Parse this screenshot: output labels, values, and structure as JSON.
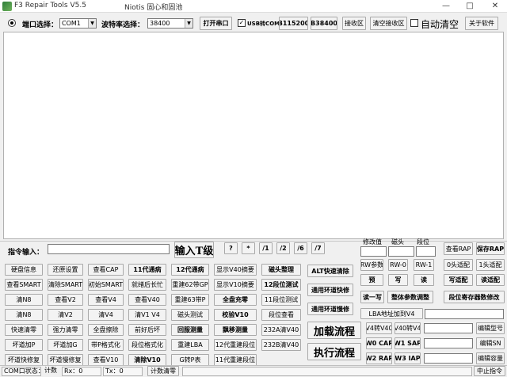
{
  "window": {
    "title": "F3 Repair Tools V5.5",
    "subtitle": "Niotis  固心和固池",
    "min": "—",
    "max": "□",
    "close": "✕"
  },
  "toolbar": {
    "port_label": "端口选择：",
    "port_value": "COM1",
    "baud_label": "波特率选择：",
    "baud_value": "38400",
    "open_port": "打开串口",
    "usb_label": "USB转COM",
    "usb_checked": "✓",
    "b115200": "B115200",
    "b38400": "B38400",
    "receive_area": "接收区",
    "clear_receive": "清空接收区",
    "auto_clear": "自动清空",
    "about": "关于软件"
  },
  "cmd": {
    "label": "指令输入：",
    "value": "",
    "enter_t": "输入T级",
    "btns": [
      "?",
      "*",
      "/1",
      "/2",
      "/6",
      "/7"
    ]
  },
  "right_panel": {
    "modify_label": "修改值",
    "head_label": "磁头",
    "segment_label": "段位",
    "rw_params": "RW参数",
    "rw0": "RW-0",
    "rw1": "RW-1",
    "preset": "预",
    "write": "写",
    "read": "读",
    "read_write": "读一写",
    "adjust_all": "整体参数调整",
    "lba_to_v4": "LBA地址加到V4",
    "v4_to_v40": "V4转V40",
    "v40_to_v4": "V40转V4",
    "w0_cap": "W0 CAP",
    "w1_sap": "W1 SAP",
    "w2_rap": "W2 RAP",
    "w3_iap": "W3 IAP",
    "view_rap": "查看RAP",
    "save_rap": "保存RAP",
    "head0_adapt": "0头适配",
    "head1_adapt": "1头适配",
    "write_adapt": "写适配",
    "read_adapt": "读适配",
    "segment_reg_modify": "段位寄存器数修改",
    "edit_model": "编辑型号",
    "edit_sn": "编辑SN",
    "edit_capacity": "编辑容量",
    "stop_cmd": "中止指令"
  },
  "mid_panel": {
    "alt_fast_clear": "ALT快速清除",
    "generic_loop_fast": "通用环道快修",
    "generic_loop_slow": "通用环道慢修",
    "load_flow": "加载流程",
    "exec_flow": "执行流程"
  },
  "grid": [
    [
      "硬盘信息",
      "还原设置",
      "查看CAP",
      "11代通病",
      "12代通病",
      "显示V40摘要",
      "磁头整理"
    ],
    [
      "查看SMART",
      "清除SMART",
      "初始SMART",
      "就绪后长忙",
      "重建62带GP",
      "显示V10摘要",
      "12段位测试"
    ],
    [
      "清N8",
      "查看V2",
      "查看V4",
      "查看V40",
      "重建63带P",
      "全盘充零",
      "11段位测试"
    ],
    [
      "清N8",
      "清V2",
      "清V4",
      "清V1 V4",
      "磁头测试",
      "校验V10",
      "段位查看"
    ],
    [
      "快速清零",
      "强力清零",
      "全盘擦除",
      "前好后坏",
      "回服测量",
      "飘移测量",
      "232A清V40"
    ],
    [
      "坏道加P",
      "坏道加G",
      "带P格式化",
      "段位格式化",
      "重建LBA",
      "12代重建段位",
      "232B清V40"
    ],
    [
      "坏道快修复",
      "坏道慢修复",
      "查看V10",
      "清除V10",
      "G转P表",
      "11代重建段位",
      ""
    ]
  ],
  "grid_bold": [
    [
      false,
      false,
      false,
      true,
      true,
      false,
      true
    ],
    [
      false,
      false,
      false,
      false,
      false,
      false,
      true
    ],
    [
      false,
      false,
      false,
      false,
      false,
      true,
      false
    ],
    [
      false,
      false,
      false,
      false,
      false,
      true,
      false
    ],
    [
      false,
      false,
      false,
      false,
      true,
      true,
      false
    ],
    [
      false,
      false,
      false,
      false,
      false,
      false,
      false
    ],
    [
      false,
      false,
      false,
      true,
      false,
      false,
      false
    ]
  ],
  "status": {
    "com_state": "COM口状态：",
    "count_label": "计数",
    "rx": "Rx：0",
    "tx": "Tx：0",
    "clear_count": "计数清零"
  }
}
